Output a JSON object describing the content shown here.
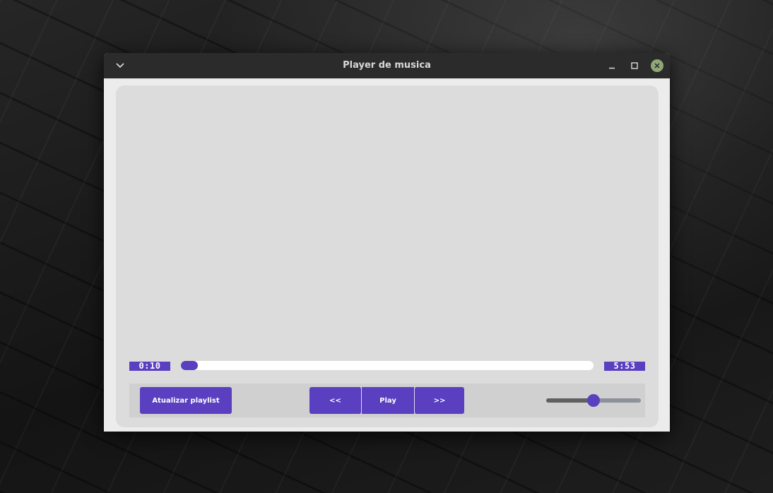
{
  "window": {
    "title": "Player de musica"
  },
  "player": {
    "elapsed": "0:10",
    "total": "5:53",
    "progress_fraction": 0.028,
    "volume_fraction": 0.5
  },
  "controls": {
    "playlist_label": "Atualizar playlist",
    "prev_label": "<<",
    "play_label": "Play",
    "next_label": ">>"
  },
  "colors": {
    "accent": "#5a3fc0",
    "close_button": "#8fa876",
    "titlebar": "#2b2b2b"
  },
  "icons": {
    "menu": "chevron-down-icon",
    "minimize": "minimize-icon",
    "maximize": "maximize-icon",
    "close": "close-icon"
  }
}
